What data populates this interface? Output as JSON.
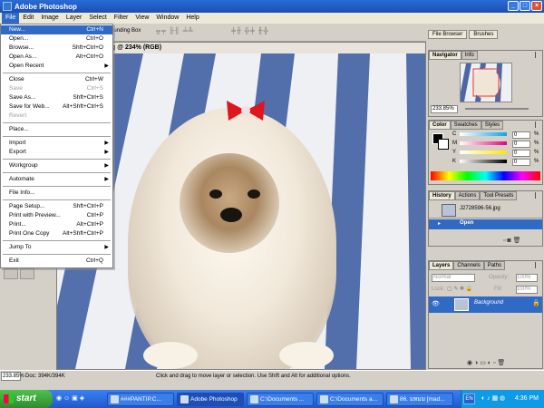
{
  "window": {
    "title": "Adobe Photoshop",
    "buttons": [
      "_",
      "□",
      "×"
    ]
  },
  "menubar": [
    "File",
    "Edit",
    "Image",
    "Layer",
    "Select",
    "Filter",
    "View",
    "Window",
    "Help"
  ],
  "options_bar": {
    "bounding_box": "ounding Box"
  },
  "dock_tabs": [
    "File Browser",
    "Brushes"
  ],
  "document": {
    "title": "g @ 234% (RGB)"
  },
  "file_menu": [
    {
      "label": "New...",
      "shortcut": "Ctrl+N",
      "highlighted": true
    },
    {
      "label": "Open...",
      "shortcut": "Ctrl+O"
    },
    {
      "label": "Browse...",
      "shortcut": "Shft+Ctrl+O"
    },
    {
      "label": "Open As...",
      "shortcut": "Alt+Ctrl+O"
    },
    {
      "label": "Open Recent",
      "submenu": true
    },
    {
      "sep": true
    },
    {
      "label": "Close",
      "shortcut": "Ctrl+W"
    },
    {
      "label": "Save",
      "shortcut": "Ctrl+S",
      "disabled": true
    },
    {
      "label": "Save As...",
      "shortcut": "Shft+Ctrl+S"
    },
    {
      "label": "Save for Web...",
      "shortcut": "Alt+Shft+Ctrl+S"
    },
    {
      "label": "Revert",
      "disabled": true
    },
    {
      "sep": true
    },
    {
      "label": "Place..."
    },
    {
      "sep": true
    },
    {
      "label": "Import",
      "submenu": true
    },
    {
      "label": "Export",
      "submenu": true
    },
    {
      "sep": true
    },
    {
      "label": "Workgroup",
      "submenu": true
    },
    {
      "sep": true
    },
    {
      "label": "Automate",
      "submenu": true
    },
    {
      "sep": true
    },
    {
      "label": "File Info..."
    },
    {
      "sep": true
    },
    {
      "label": "Page Setup...",
      "shortcut": "Shft+Ctrl+P"
    },
    {
      "label": "Print with Preview...",
      "shortcut": "Ctrl+P"
    },
    {
      "label": "Print...",
      "shortcut": "Alt+Ctrl+P"
    },
    {
      "label": "Print One Copy",
      "shortcut": "Alt+Shft+Ctrl+P"
    },
    {
      "sep": true
    },
    {
      "label": "Jump To",
      "submenu": true
    },
    {
      "sep": true
    },
    {
      "label": "Exit",
      "shortcut": "Ctrl+Q"
    }
  ],
  "status": {
    "zoom": "233.85%",
    "doc": "Doc: 394K/394K",
    "hint": "Click and drag to move layer or selection. Use Shift and Alt for additional options."
  },
  "navigator": {
    "tabs": [
      "Navigator",
      "Info"
    ],
    "zoom": "233.85%"
  },
  "color": {
    "tabs": [
      "Color",
      "Swatches",
      "Styles"
    ],
    "channels": [
      {
        "label": "C",
        "value": "0",
        "unit": "%"
      },
      {
        "label": "M",
        "value": "0",
        "unit": "%"
      },
      {
        "label": "Y",
        "value": "0",
        "unit": "%"
      },
      {
        "label": "K",
        "value": "0",
        "unit": "%"
      }
    ]
  },
  "history": {
    "tabs": [
      "History",
      "Actions",
      "Tool Presets"
    ],
    "snapshot": "J2728596-56.jpg",
    "step": "Open"
  },
  "layers": {
    "tabs": [
      "Layers",
      "Channels",
      "Paths"
    ],
    "blend_mode": "Normal",
    "opacity_label": "Opacity:",
    "opacity": "100%",
    "lock_label": "Lock:",
    "fill_label": "Fill:",
    "fill": "100%",
    "layer_name": "Background"
  },
  "taskbar": {
    "start": "start",
    "buttons": [
      {
        "label": "###PANTIP.C...",
        "active": false
      },
      {
        "label": "Adobe Photoshop",
        "active": true
      },
      {
        "label": "C:\\Documents ...",
        "active": false
      },
      {
        "label": "C:\\Documents a...",
        "active": false
      },
      {
        "label": "86. มหมม [mad...",
        "active": false
      }
    ],
    "lang": "EN",
    "clock": "4:36 PM"
  }
}
